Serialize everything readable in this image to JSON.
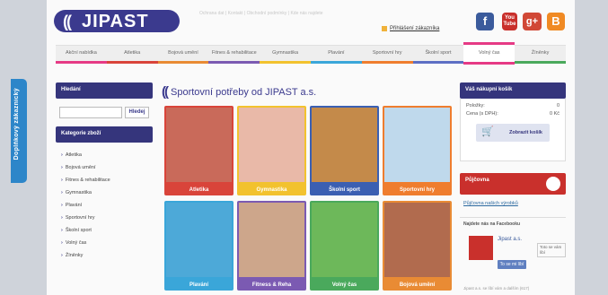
{
  "side_tab": {
    "label": "Doplňkový zákaznický"
  },
  "header": {
    "logo_mark": "((",
    "logo_text": "JIPAST",
    "top_links": "Ochrana dat  |  Kontakt  |  Obchodní podmínky  |  Kde nás najdete",
    "login": "Přihlášení zákazníka"
  },
  "social": [
    {
      "icon": "facebook-icon",
      "text": "f"
    },
    {
      "icon": "youtube-icon",
      "text": "You Tube"
    },
    {
      "icon": "google-plus-icon",
      "text": "g+"
    },
    {
      "icon": "blogger-icon",
      "text": "B"
    }
  ],
  "nav": [
    {
      "label": "Akční nabídka",
      "color": "#e63a85",
      "active": false
    },
    {
      "label": "Atletika",
      "color": "#d9443a",
      "active": false
    },
    {
      "label": "Bojová umění",
      "color": "#e98b34",
      "active": false
    },
    {
      "label": "Fitnes & rehabilitace",
      "color": "#7b5ab2",
      "active": false
    },
    {
      "label": "Gymnastika",
      "color": "#f2c22e",
      "active": false
    },
    {
      "label": "Plavání",
      "color": "#3aa6d9",
      "active": false
    },
    {
      "label": "Sportovní hry",
      "color": "#ef7d2e",
      "active": false
    },
    {
      "label": "Školní sport",
      "color": "#5d6fc4",
      "active": false
    },
    {
      "label": "Volný čas",
      "color": "#e63a85",
      "active": true
    },
    {
      "label": "Žíněnky",
      "color": "#4aa95c",
      "active": false
    }
  ],
  "left": {
    "search_title": "Hledání",
    "search_placeholder": "",
    "search_button": "Hledej",
    "categories_title": "Kategorie zboží",
    "categories": [
      "Atletika",
      "Bojová umění",
      "Fitnes & rehabilitace",
      "Gymnastika",
      "Plavání",
      "Sportovní hry",
      "Školní sport",
      "Volný čas",
      "Žíněnky"
    ]
  },
  "main": {
    "title_mark": "((",
    "title": "Sportovní potřeby od JIPAST a.s.",
    "tiles": [
      {
        "label": "Atletika",
        "color": "#d9443a",
        "photo": "#c96a5a"
      },
      {
        "label": "Gymnastika",
        "color": "#f2c22e",
        "photo": "#e9b9a8"
      },
      {
        "label": "Školní sport",
        "color": "#3b5fb2",
        "photo": "#c48a4a"
      },
      {
        "label": "Sportovní hry",
        "color": "#ef7d2e",
        "photo": "#bfd9ec"
      },
      {
        "label": "Plavání",
        "color": "#3aa6d9",
        "photo": "#4da9d8"
      },
      {
        "label": "Fitness & Reha",
        "color": "#7b5ab2",
        "photo": "#cda68b"
      },
      {
        "label": "Volný čas",
        "color": "#4aa95c",
        "photo": "#6db85a"
      },
      {
        "label": "Bojová umění",
        "color": "#e98b34",
        "photo": "#b16b4e"
      }
    ]
  },
  "cart": {
    "title": "Váš nákupní košík",
    "items_label": "Položky:",
    "items_value": "0",
    "price_label": "Cena (s DPH):",
    "price_value": "0 Kč",
    "button": "Zobrazit košík"
  },
  "loan": {
    "title": "Půjčovna",
    "link": "Půjčovna našich výrobků"
  },
  "facebook": {
    "heading": "Najdete nás na Facebooku",
    "name": "Jipast a.s.",
    "like": "To se mi líbí",
    "bubble": "Toto se vám líbí",
    "footer": "Jipast a.s. se líbí vám a dalším (617)"
  }
}
